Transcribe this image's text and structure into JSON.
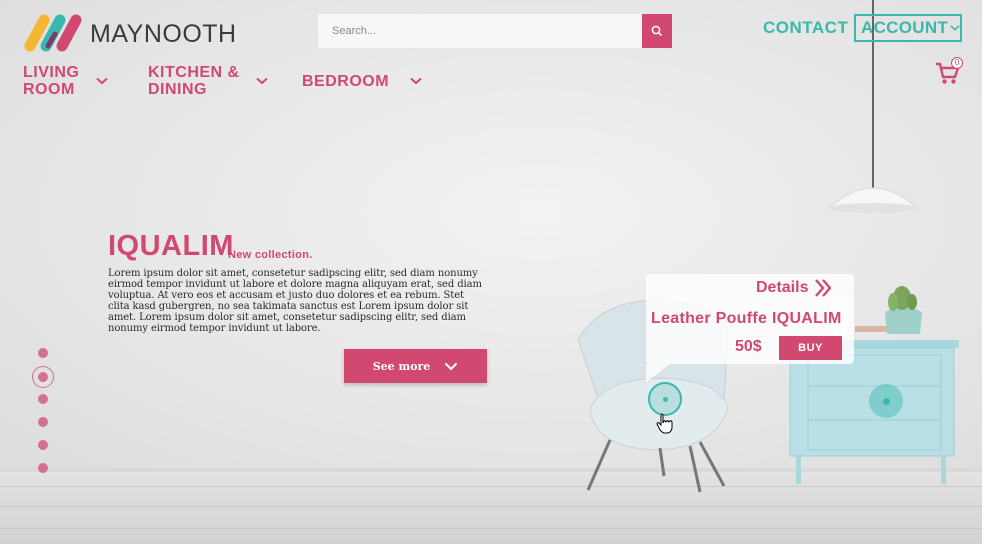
{
  "brand": {
    "name": "MAYNOOTH",
    "colors": [
      "#f5b731",
      "#3bb8ad",
      "#d14871",
      "#7a3b6b"
    ]
  },
  "search": {
    "placeholder": "Search...",
    "icon": "search-icon"
  },
  "header": {
    "contact_label": "CONTACT",
    "account_label": "ACCOUNT",
    "cart_count": "0"
  },
  "nav": {
    "items": [
      {
        "line1": "LIVING",
        "line2": "ROOM"
      },
      {
        "line1": "KITCHEN &",
        "line2": "DINING"
      },
      {
        "line1": "BEDROOM",
        "line2": ""
      }
    ]
  },
  "hero": {
    "title": "IQUALIM",
    "subtitle": "New collection.",
    "body": "Lorem ipsum dolor sit amet, consetetur sadipscing elitr, sed diam nonumy eirmod tempor invidunt ut labore et dolore magna aliquyam erat, sed diam voluptua. At vero eos et accusam et justo duo dolores et ea rebum. Stet clita kasd gubergren, no sea takimata sanctus est Lorem ipsum dolor sit amet. Lorem ipsum dolor sit amet, consetetur sadipscing elitr, sed diam nonumy eirmod tempor invidunt ut labore.",
    "cta_label": "See more"
  },
  "slider": {
    "slide_count": 6,
    "active_index": 1
  },
  "product_popup": {
    "details_label": "Details",
    "name": "Leather Pouffe IQUALIM",
    "price": "50$",
    "buy_label": "BUY"
  },
  "theme": {
    "accent": "#d14871",
    "secondary": "#3bb8ad",
    "text": "#2a2a2a"
  }
}
